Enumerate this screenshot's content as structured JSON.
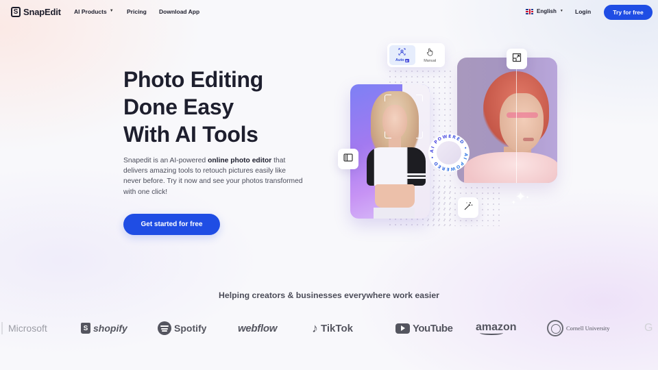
{
  "nav": {
    "brand": "SnapEdit",
    "logo_glyph": "S",
    "links": [
      {
        "label": "AI Products",
        "has_dropdown": true
      },
      {
        "label": "Pricing"
      },
      {
        "label": "Download App"
      }
    ],
    "language": {
      "label": "English",
      "flag": "uk-flag-icon"
    },
    "login": "Login",
    "cta": "Try for free"
  },
  "hero": {
    "title_lines": [
      "Photo Editing",
      "Done Easy",
      "With AI Tools"
    ],
    "description": {
      "before": "Snapedit is an AI-powered ",
      "bold": "online photo editor",
      "after": " that delivers amazing tools to retouch pictures easily like never before. Try it now and see your photos transformed with one click!"
    },
    "cta": "Get started for free"
  },
  "illustration": {
    "modes": [
      {
        "label": "Auto",
        "badge": "AI",
        "icon": "face-scan-icon",
        "selected": true
      },
      {
        "label": "Manual",
        "icon": "hand-pointer-icon",
        "selected": false
      }
    ],
    "badge_text": "AI POWERED • AI POWERED •",
    "tools": [
      "compare-icon",
      "expand-icon",
      "magic-wand-icon"
    ]
  },
  "trust": {
    "heading": "Helping creators & businesses everywhere work easier",
    "logos": [
      "Microsoft",
      "shopify",
      "Spotify",
      "webflow",
      "TikTok",
      "YouTube",
      "amazon",
      "Cornell University",
      "G"
    ]
  },
  "colors": {
    "primary": "#1f4de4",
    "text": "#1e1f2e",
    "muted": "#4a4c5a",
    "logo_gray": "#54555f"
  }
}
